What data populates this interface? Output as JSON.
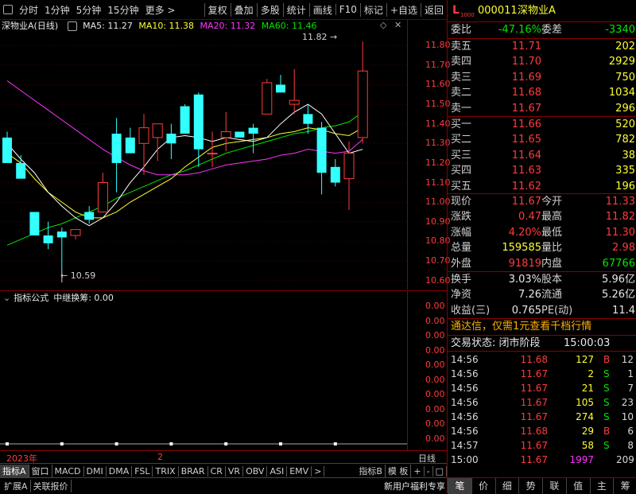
{
  "toolbar": {
    "left_items": [
      "分时",
      "1分钟",
      "5分钟",
      "15分钟",
      "更多 >"
    ],
    "right_items": [
      "复权",
      "叠加",
      "多股",
      "统计",
      "画线",
      "F10",
      "标记",
      "+自选",
      "返回"
    ]
  },
  "chart": {
    "stock_label": "深物业A(日线)",
    "ma5": "MA5: 11.27",
    "ma10": "MA10: 11.38",
    "ma20": "MA20: 11.32",
    "ma60": "MA60: 11.46",
    "high_marker": "11.82",
    "low_marker": "10.59",
    "y_ticks": [
      "11.80",
      "11.70",
      "11.60",
      "11.50",
      "11.40",
      "11.30",
      "11.20",
      "11.10",
      "11.00",
      "10.90",
      "10.80",
      "10.70",
      "10.60"
    ],
    "colors": {
      "ma5": "#ffffff",
      "ma10": "#ffff33",
      "ma20": "#ff33ff",
      "ma60": "#00e600",
      "up": "#ff3b3b",
      "down": "#33ffff"
    }
  },
  "chart_data": {
    "type": "candlestick",
    "ohlc": [
      [
        11.33,
        11.36,
        11.2,
        11.2
      ],
      [
        11.2,
        11.24,
        11.12,
        11.12
      ],
      [
        10.95,
        10.95,
        10.83,
        10.83
      ],
      [
        10.83,
        10.9,
        10.76,
        10.79
      ],
      [
        10.85,
        10.87,
        10.66,
        10.82
      ],
      [
        10.83,
        10.86,
        10.81,
        10.86
      ],
      [
        10.95,
        10.98,
        10.89,
        10.91
      ],
      [
        10.95,
        11.15,
        10.95,
        11.1
      ],
      [
        11.35,
        11.43,
        11.05,
        11.2
      ],
      [
        11.33,
        11.38,
        11.25,
        11.25
      ],
      [
        11.3,
        11.45,
        11.14,
        11.38
      ],
      [
        11.33,
        11.4,
        11.21,
        11.4
      ],
      [
        11.35,
        11.4,
        11.22,
        11.3
      ],
      [
        11.49,
        11.5,
        11.35,
        11.35
      ],
      [
        11.55,
        11.56,
        11.18,
        11.27
      ],
      [
        11.25,
        11.36,
        11.18,
        11.25
      ],
      [
        11.33,
        11.46,
        11.26,
        11.36
      ],
      [
        11.36,
        11.35,
        11.33,
        11.33
      ],
      [
        11.38,
        11.4,
        11.25,
        11.35
      ],
      [
        11.45,
        11.63,
        11.45,
        11.61
      ],
      [
        11.6,
        11.65,
        11.56,
        11.56
      ],
      [
        11.5,
        11.68,
        11.45,
        11.52
      ],
      [
        11.45,
        11.5,
        11.35,
        11.4
      ],
      [
        11.38,
        11.41,
        11.04,
        11.15
      ],
      [
        11.18,
        11.22,
        11.08,
        11.1
      ],
      [
        11.12,
        11.31,
        10.96,
        11.25
      ],
      [
        11.33,
        11.82,
        11.3,
        11.67
      ]
    ],
    "ma5": [
      11.3,
      11.22,
      11.15,
      11.05,
      10.98,
      10.92,
      10.88,
      10.92,
      11.0,
      11.1,
      11.18,
      11.27,
      11.33,
      11.34,
      11.33,
      11.31,
      11.33,
      11.32,
      11.31,
      11.33,
      11.4,
      11.46,
      11.5,
      11.45,
      11.35,
      11.25,
      11.27
    ],
    "ma10": [
      11.25,
      11.2,
      11.12,
      11.05,
      11.0,
      10.95,
      10.92,
      10.92,
      10.95,
      11.0,
      11.04,
      11.08,
      11.12,
      11.18,
      11.23,
      11.28,
      11.3,
      11.31,
      11.32,
      11.33,
      11.35,
      11.36,
      11.38,
      11.37,
      11.35,
      11.34,
      11.38
    ],
    "ma20": [
      11.62,
      11.57,
      11.52,
      11.47,
      11.42,
      11.37,
      11.32,
      11.27,
      11.23,
      11.19,
      11.16,
      11.14,
      11.14,
      11.14,
      11.15,
      11.17,
      11.19,
      11.2,
      11.21,
      11.22,
      11.24,
      11.25,
      11.27,
      11.26,
      11.25,
      11.26,
      11.32
    ],
    "ma60": [
      10.78,
      10.81,
      10.84,
      10.87,
      10.89,
      10.92,
      10.95,
      10.98,
      11.02,
      11.05,
      11.08,
      11.11,
      11.14,
      11.16,
      11.19,
      11.22,
      11.25,
      11.27,
      11.29,
      11.31,
      11.33,
      11.35,
      11.36,
      11.38,
      11.39,
      11.41,
      11.46
    ],
    "ylim": [
      10.57,
      11.87
    ]
  },
  "indicator": {
    "formula_label": "指标公式",
    "name_value": "中继换筹: 0.00",
    "y_ticks": [
      "0.00",
      "0.00",
      "0.00",
      "0.00",
      "0.00",
      "0.00",
      "0.00",
      "0.00",
      "0.00",
      "0.00"
    ]
  },
  "datebar": {
    "year": "2023年",
    "mark": "2",
    "right_label": "日线"
  },
  "tabs": [
    "指标A",
    "窗口",
    "MACD",
    "DMI",
    "DMA",
    "FSL",
    "TRIX",
    "BRAR",
    "CR",
    "VR",
    "OBV",
    "ASI",
    "EMV",
    ">",
    "指标B",
    "模 板",
    "+",
    "-",
    "□"
  ],
  "status": {
    "left": [
      "扩展A",
      "关联报价"
    ],
    "right": "新用户福利专享"
  },
  "quote": {
    "code": "000011",
    "name": "深物业A",
    "weibi_label": "委比",
    "weibi": "-47.16%",
    "weicha_label": "委差",
    "weicha": "-3340",
    "sells": [
      {
        "label": "卖五",
        "price": "11.71",
        "vol": "202"
      },
      {
        "label": "卖四",
        "price": "11.70",
        "vol": "2929"
      },
      {
        "label": "卖三",
        "price": "11.69",
        "vol": "750"
      },
      {
        "label": "卖二",
        "price": "11.68",
        "vol": "1034"
      },
      {
        "label": "卖一",
        "price": "11.67",
        "vol": "296"
      }
    ],
    "buys": [
      {
        "label": "买一",
        "price": "11.66",
        "vol": "520"
      },
      {
        "label": "买二",
        "price": "11.65",
        "vol": "782"
      },
      {
        "label": "买三",
        "price": "11.64",
        "vol": "38"
      },
      {
        "label": "买四",
        "price": "11.63",
        "vol": "335"
      },
      {
        "label": "买五",
        "price": "11.62",
        "vol": "196"
      }
    ],
    "stats": [
      {
        "l1": "现价",
        "v1": "11.67",
        "c1": "red",
        "l2": "今开",
        "v2": "11.33",
        "c2": "red"
      },
      {
        "l1": "涨跌",
        "v1": "0.47",
        "c1": "red",
        "l2": "最高",
        "v2": "11.82",
        "c2": "red"
      },
      {
        "l1": "涨幅",
        "v1": "4.20%",
        "c1": "red",
        "l2": "最低",
        "v2": "11.30",
        "c2": "red"
      },
      {
        "l1": "总量",
        "v1": "159585",
        "c1": "yellow",
        "l2": "量比",
        "v2": "2.98",
        "c2": "red"
      },
      {
        "l1": "外盘",
        "v1": "91819",
        "c1": "red",
        "l2": "内盘",
        "v2": "67766",
        "c2": "green"
      }
    ],
    "finance": [
      {
        "l1": "换手",
        "v1": "3.03%",
        "l2": "股本",
        "v2": "5.96亿"
      },
      {
        "l1": "净资",
        "v1": "7.26",
        "l2": "流通",
        "v2": "5.26亿"
      },
      {
        "l1": "收益(三)",
        "v1": "0.765",
        "l2": "PE(动)",
        "v2": "11.4"
      }
    ],
    "ad": "通达信，仅需1元查看千档行情",
    "trade_status_label": "交易状态: 闭市阶段",
    "trade_status_time": "15:00:03",
    "ticks": [
      {
        "t": "14:56",
        "p": "11.68",
        "v": "127",
        "d": "B",
        "n": "12"
      },
      {
        "t": "14:56",
        "p": "11.67",
        "v": "2",
        "d": "S",
        "n": "1"
      },
      {
        "t": "14:56",
        "p": "11.67",
        "v": "21",
        "d": "S",
        "n": "7"
      },
      {
        "t": "14:56",
        "p": "11.67",
        "v": "105",
        "d": "S",
        "n": "23"
      },
      {
        "t": "14:56",
        "p": "11.67",
        "v": "274",
        "d": "S",
        "n": "10"
      },
      {
        "t": "14:56",
        "p": "11.68",
        "v": "29",
        "d": "B",
        "n": "6"
      },
      {
        "t": "14:57",
        "p": "11.67",
        "v": "58",
        "d": "S",
        "n": "8"
      },
      {
        "t": "15:00",
        "p": "11.67",
        "v": "1997",
        "d": "",
        "n": "209"
      }
    ],
    "bottom_tabs": [
      "笔",
      "价",
      "细",
      "势",
      "联",
      "值",
      "主",
      "筹"
    ]
  }
}
